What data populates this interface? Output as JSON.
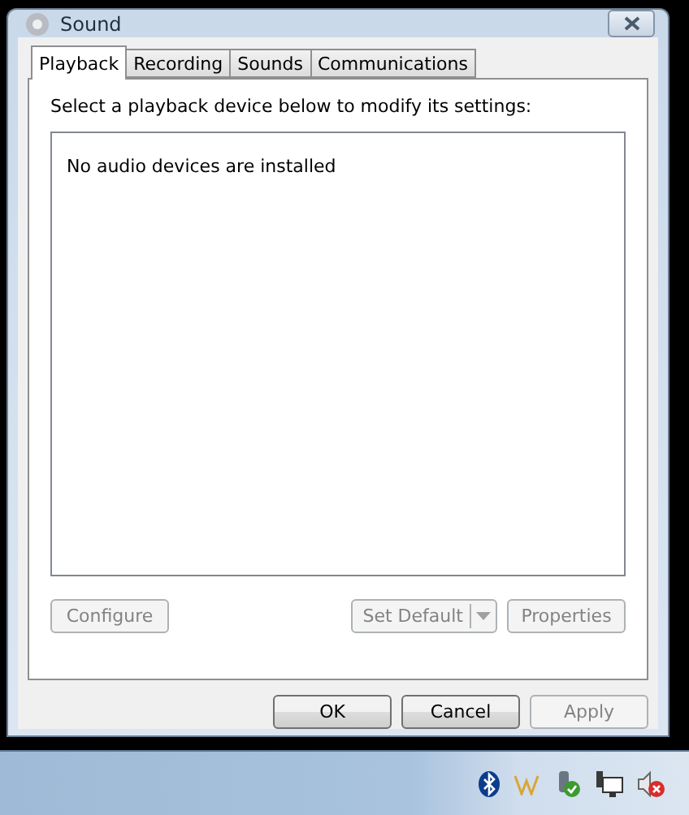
{
  "window": {
    "title": "Sound"
  },
  "tabs": [
    {
      "label": "Playback",
      "selected": true
    },
    {
      "label": "Recording",
      "selected": false
    },
    {
      "label": "Sounds",
      "selected": false
    },
    {
      "label": "Communications",
      "selected": false
    }
  ],
  "instruction": "Select a playback device below to modify its settings:",
  "device_list": {
    "empty_message": "No audio devices are installed"
  },
  "device_buttons": [
    {
      "kind": "plain",
      "label": "Configure",
      "disabled": true
    },
    {
      "kind": "split",
      "label": "Set Default",
      "disabled": true
    },
    {
      "kind": "plain",
      "label": "Properties",
      "disabled": true
    }
  ],
  "dialog_buttons": [
    {
      "label": "OK",
      "disabled": false
    },
    {
      "label": "Cancel",
      "disabled": false
    },
    {
      "label": "Apply",
      "disabled": true
    }
  ],
  "tray_icons": [
    {
      "kind": "bluetooth"
    },
    {
      "kind": "app"
    },
    {
      "kind": "usb"
    },
    {
      "kind": "network"
    },
    {
      "kind": "volume"
    }
  ]
}
